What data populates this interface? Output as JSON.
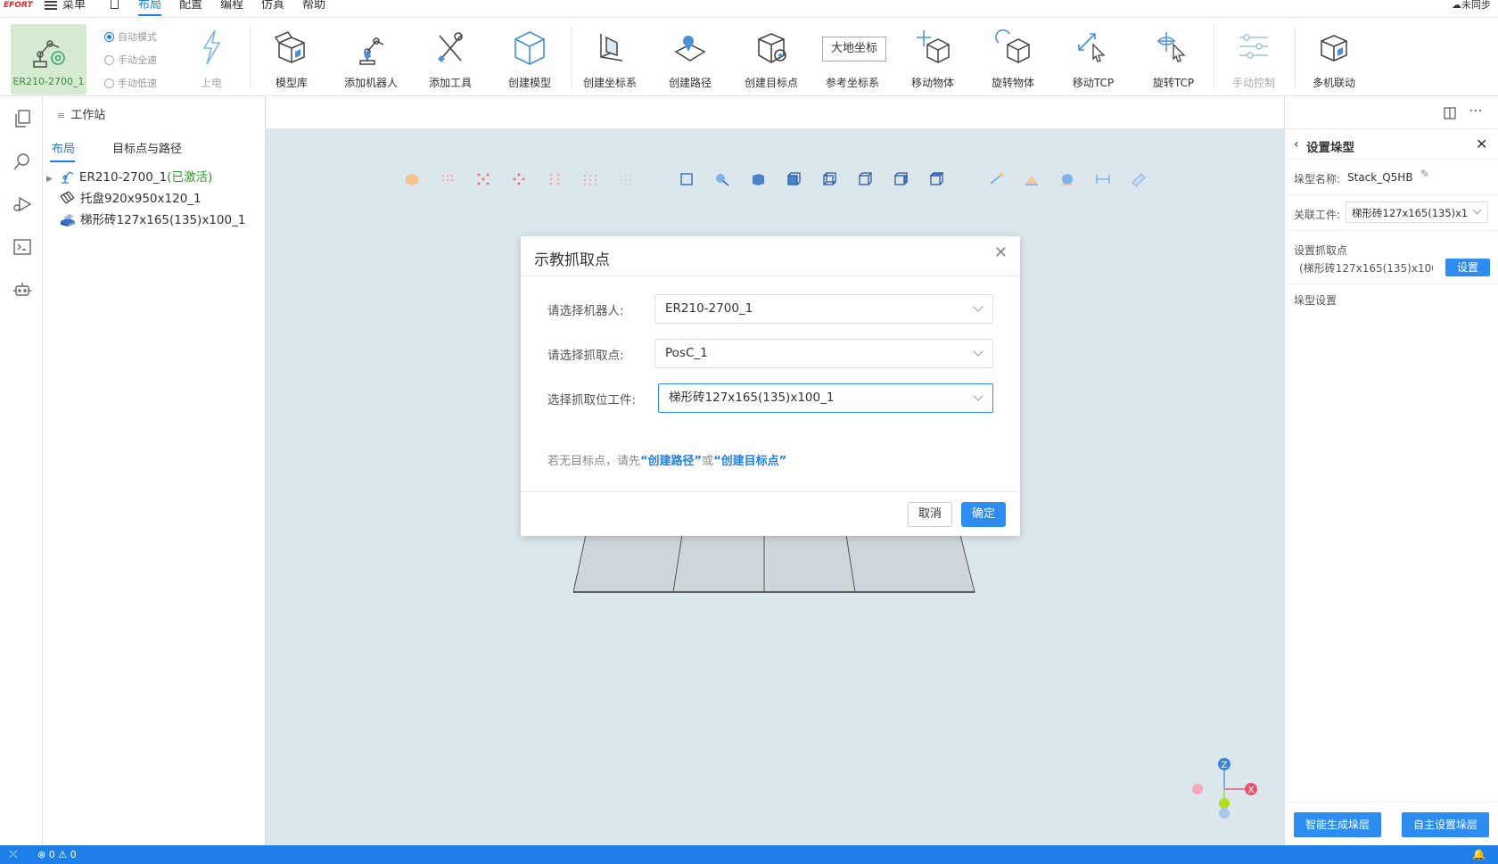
{
  "menubar": {
    "logo": "EFORT",
    "items": [
      "菜单",
      "布局",
      "配置",
      "编程",
      "仿真",
      "帮助"
    ],
    "active": "布局",
    "sync_status": "未同步"
  },
  "ribbon": {
    "robot_tile_label": "ER210-2700_1",
    "modes": [
      "自动模式",
      "手动全速",
      "手动低速"
    ],
    "power_label": "上电",
    "tools": [
      "模型库",
      "添加机器人",
      "添加工具",
      "创建模型",
      "创建坐标系",
      "创建路径",
      "创建目标点",
      "参考坐标系",
      "移动物体",
      "旋转物体",
      "移动TCP",
      "旋转TCP",
      "手动控制",
      "多机联动"
    ],
    "coord_box": "大地坐标"
  },
  "explorer": {
    "title": "工作站",
    "tabs": [
      "布局",
      "目标点与路径"
    ],
    "tree": [
      {
        "label": "ER210-2700_1",
        "status": "(已激活)"
      },
      {
        "label": "托盘920x950x120_1"
      },
      {
        "label": "梯形砖127x165(135)x100_1"
      }
    ]
  },
  "right_panel": {
    "title": "设置垛型",
    "name_label": "垛型名称:",
    "name_value": "Stack_Q5HB",
    "workpiece_label": "关联工件:",
    "workpiece_value": "梯形砖127x165(135)x1(",
    "grab_label": "设置抓取点",
    "grab_value": "(梯形砖127x165(135)x100_...",
    "grab_button": "设置",
    "stack_settings": "垛型设置",
    "auto_button": "智能生成垛层",
    "manual_button": "自主设置垛层"
  },
  "dialog": {
    "title": "示教抓取点",
    "robot_label": "请选择机器人:",
    "robot_value": "ER210-2700_1",
    "point_label": "请选择抓取点:",
    "point_value": "PosC_1",
    "workpiece_label": "选择抓取位工件:",
    "workpiece_value": "梯形砖127x165(135)x100_1",
    "hint_prefix": "若无目标点，请先",
    "hint_link1": "“创建路径”",
    "hint_mid": "或",
    "hint_link2": "“创建目标点”",
    "cancel": "取消",
    "confirm": "确定"
  },
  "status_bar": {
    "errors": "0",
    "warnings": "0"
  },
  "axes": {
    "z": "Z",
    "x": "X"
  },
  "colors": {
    "accent": "#1e7fe8",
    "canvas_bg": "#dbe7ec",
    "robot_tile_bg": "#d6ead1"
  }
}
